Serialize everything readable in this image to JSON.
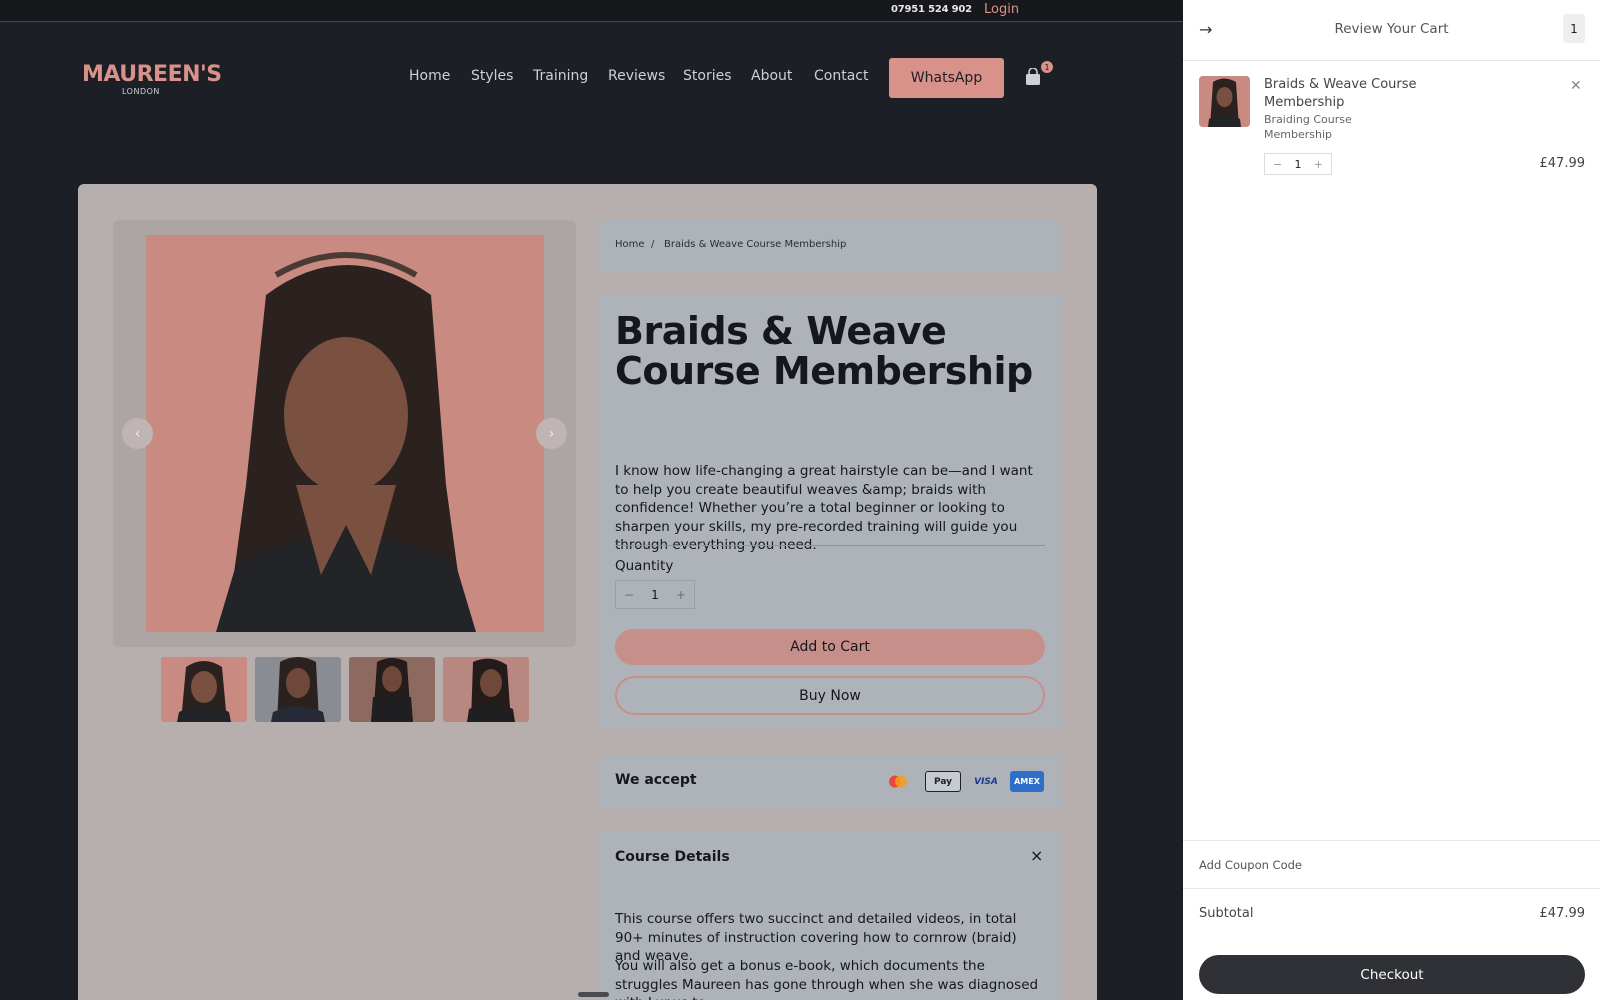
{
  "topbar": {
    "phone": "07951 524 902",
    "login": "Login"
  },
  "header": {
    "logo_main": "MAUREEN'S",
    "logo_sub": "LONDON",
    "nav": [
      "Home",
      "Styles",
      "Training",
      "Reviews",
      "Stories",
      "About",
      "Contact"
    ],
    "whatsapp": "WhatsApp",
    "cart_count": "1"
  },
  "breadcrumb": {
    "home": "Home",
    "sep": "/",
    "current": "Braids & Weave Course Membership"
  },
  "product": {
    "title": "Braids & Weave Course Membership",
    "description": "I know how life-changing a great hairstyle can be—and I want to help you create beautiful weaves &amp; braids with confidence! Whether you’re a total beginner or looking to sharpen your skills, my pre-recorded training will guide you through everything you need.",
    "quantity_label": "Quantity",
    "quantity": "1",
    "minus": "−",
    "plus": "+",
    "add_to_cart": "Add to Cart",
    "buy_now": "Buy Now"
  },
  "payments": {
    "label": "We accept",
    "methods": [
      "Mastercard",
      "Pay",
      "VISA",
      "AMEX"
    ]
  },
  "details": {
    "label": "Course Details",
    "close": "×",
    "p1": "This course offers two succinct and detailed videos, in total 90+ minutes of instruction covering how to cornrow (braid) and weave.",
    "p2": "You will also get a bonus e-book, which documents the struggles Maureen has gone through when she was diagnosed with Lupus to"
  },
  "cart": {
    "title": "Review Your Cart",
    "count": "1",
    "item_name": "Braids & Weave Course Membership",
    "item_sub": "Braiding Course Membership",
    "item_qty": "1",
    "item_price": "£47.99",
    "coupon": "Add Coupon Code",
    "subtotal_label": "Subtotal",
    "subtotal": "£47.99",
    "checkout": "Checkout"
  },
  "colors": {
    "accent": "#d9928a",
    "page_bg": "#1d1f27",
    "card_bg": "#b7aeae",
    "panel_bg": "#aeb3ba",
    "checkout_bg": "#2f3136"
  }
}
